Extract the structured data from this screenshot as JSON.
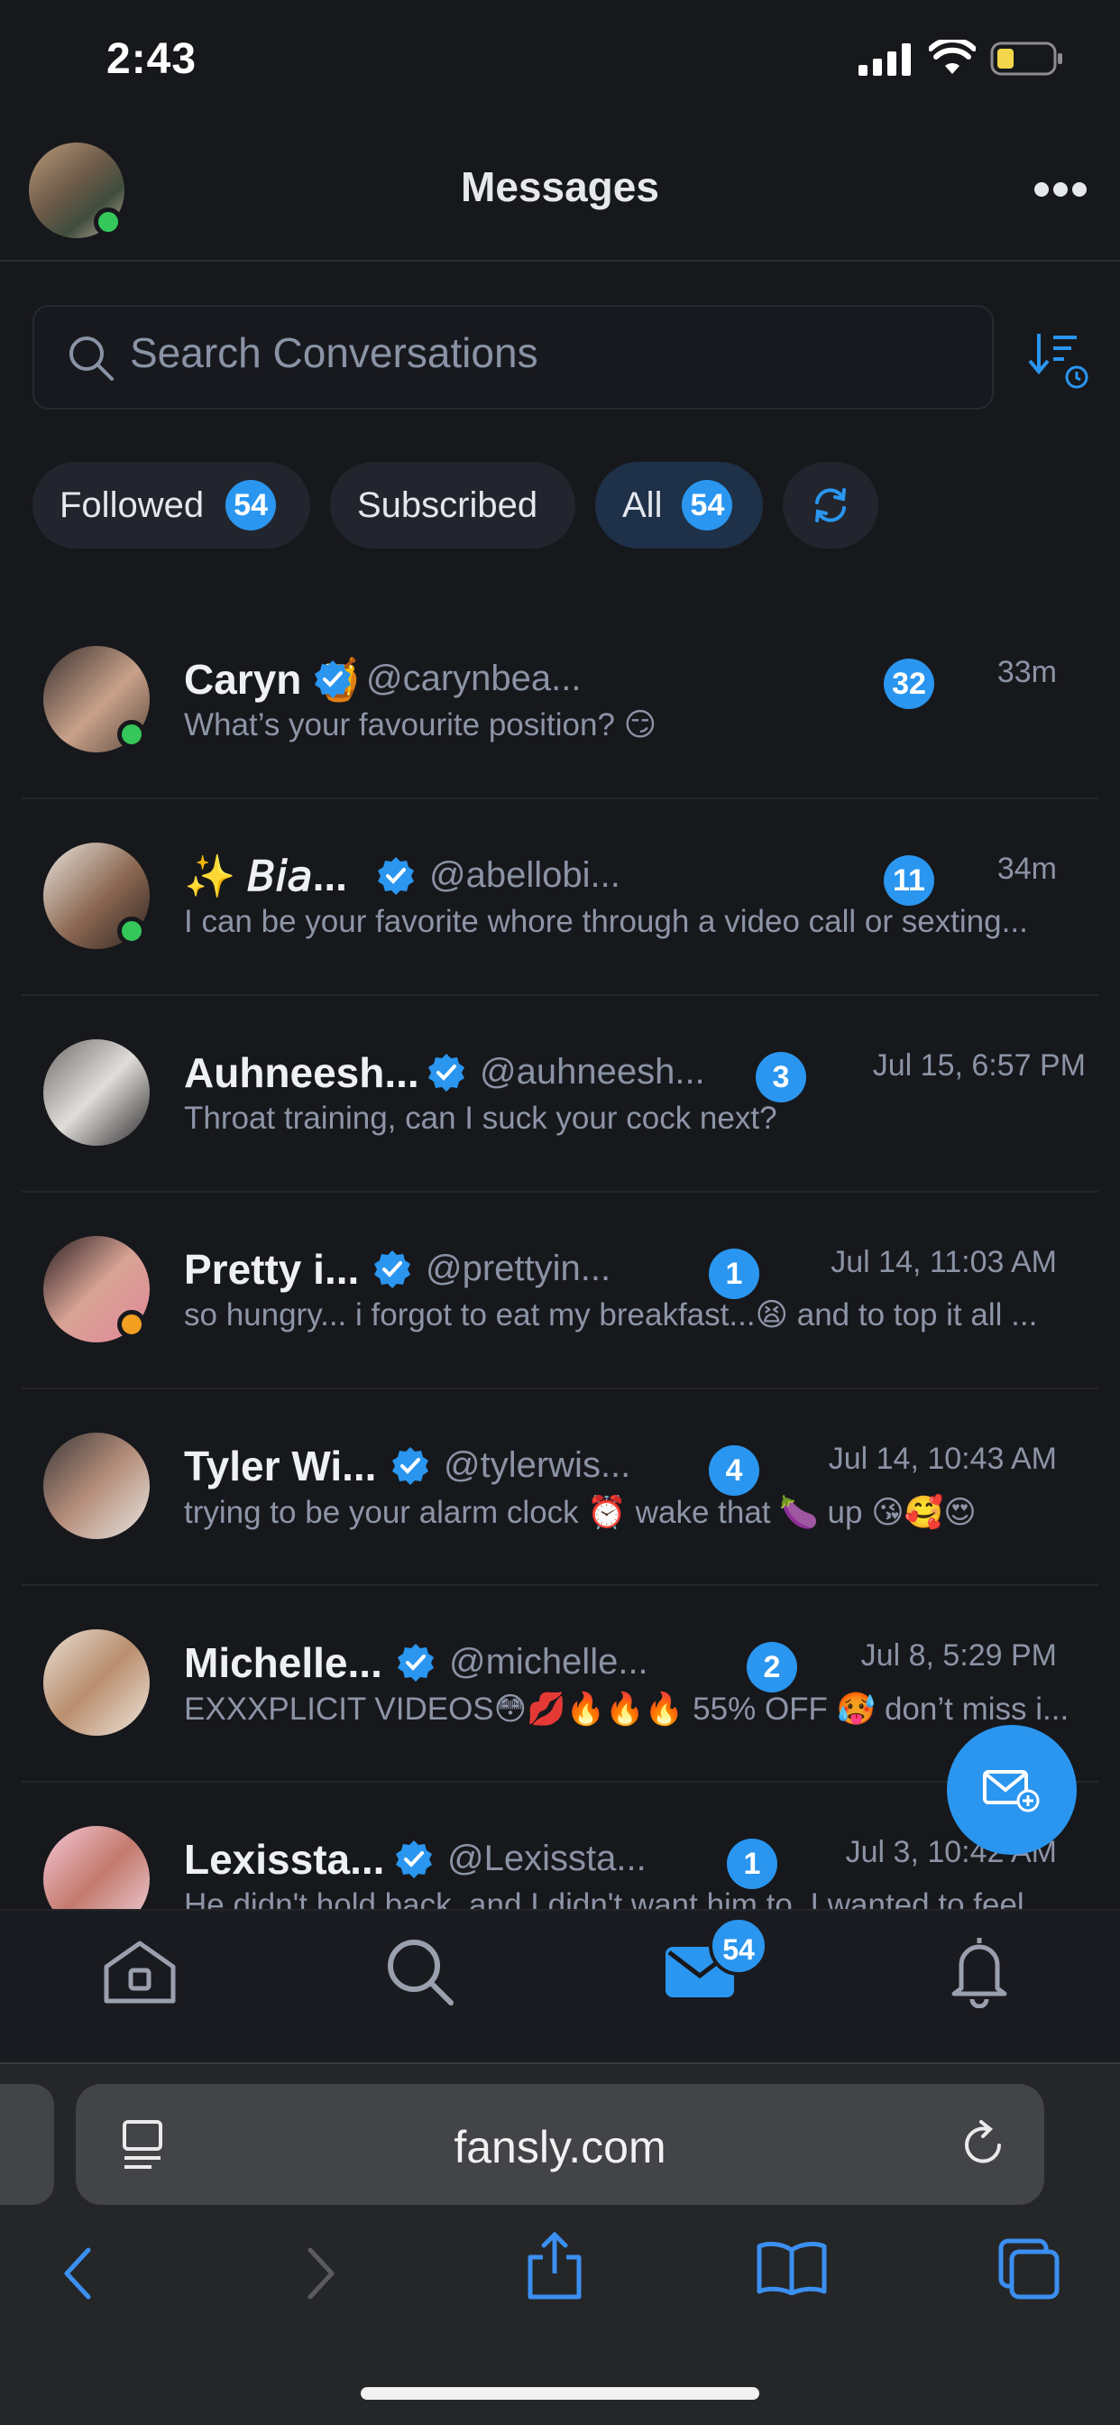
{
  "status_bar": {
    "time": "2:43"
  },
  "header": {
    "title": "Messages",
    "avatar_icon": "user-avatar",
    "more_icon": "more-horizontal-icon"
  },
  "search": {
    "placeholder": "Search Conversations",
    "sort_icon": "sort-by-time-icon"
  },
  "filters": [
    {
      "label": "Followed",
      "count": "54"
    },
    {
      "label": "Subscribed",
      "count": ""
    },
    {
      "label": "All",
      "count": "54",
      "active": true
    },
    {
      "label": "",
      "icon": "refresh-icon"
    }
  ],
  "conversations": [
    {
      "name": "Caryn 🍯",
      "handle": "@carynbea...",
      "unread": "32",
      "time": "33m",
      "preview": "What’s your favourite position? 😏",
      "online": true
    },
    {
      "name": "✨ 𝘉𝘪𝘢...",
      "handle": "@abellobi...",
      "unread": "11",
      "time": "34m",
      "preview": "I can be your favorite whore through a video call or sexting...",
      "online": true
    },
    {
      "name": "Auhneesh...",
      "handle": "@auhneesh...",
      "unread": "3",
      "time": "Jul 15, 6:57 PM",
      "preview": "Throat training, can I suck your cock next?",
      "online": false
    },
    {
      "name": "Pretty i...",
      "handle": "@prettyin...",
      "unread": "1",
      "time": "Jul 14, 11:03 AM",
      "preview": "so hungry... i forgot to eat my breakfast...😫 and to top it all ...",
      "online": false,
      "away": true
    },
    {
      "name": "Tyler Wi...",
      "handle": "@tylerwis...",
      "unread": "4",
      "time": "Jul 14, 10:43 AM",
      "preview": "trying to be your alarm clock ⏰ wake that 🍆 up 😘🥰😍",
      "online": false
    },
    {
      "name": "Michelle...",
      "handle": "@michelle...",
      "unread": "2",
      "time": "Jul 8, 5:29 PM",
      "preview": "EXXXPLICIT VIDEOS😳💋🔥🔥🔥 55% OFF 🥵 don’t miss i...",
      "online": false
    },
    {
      "name": "Lexissta...",
      "handle": "@Lexissta...",
      "unread": "1",
      "time": "Jul 3, 10:42 AM",
      "preview": "He didn't hold back, and I didn't want him to. I wanted to feel",
      "online": false
    }
  ],
  "fab": {
    "icon": "new-message-icon"
  },
  "bottom_nav": {
    "items": [
      "home-icon",
      "search-icon",
      "messages-icon",
      "notifications-icon"
    ],
    "messages_badge": "54"
  },
  "browser": {
    "url": "fansly.com",
    "buttons": [
      "back-icon",
      "forward-icon",
      "share-icon",
      "bookmarks-icon",
      "tabs-icon"
    ]
  },
  "colors": {
    "accent": "#2a96f0",
    "background": "#17181c",
    "online": "#35c759"
  }
}
